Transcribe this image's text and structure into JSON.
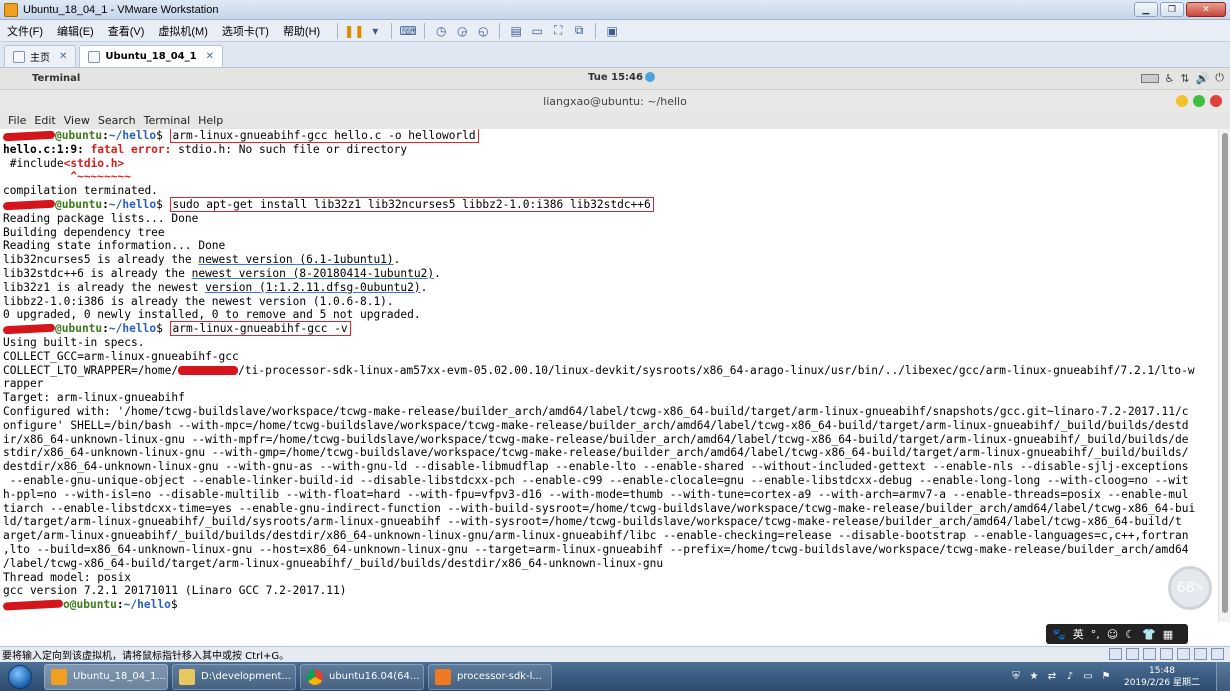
{
  "vmware": {
    "title": "Ubuntu_18_04_1 - VMware Workstation",
    "menu": [
      "文件(F)",
      "编辑(E)",
      "查看(V)",
      "虚拟机(M)",
      "选项卡(T)",
      "帮助(H)"
    ],
    "tabs": [
      {
        "label": "主页"
      },
      {
        "label": "Ubuntu_18_04_1",
        "active": true
      }
    ],
    "status_text": "要将输入定向到该虚拟机，请将鼠标指针移入其中或按 Ctrl+G。"
  },
  "ubuntu_panel": {
    "app_name": "Terminal",
    "clock": "Tue 15:46"
  },
  "terminal": {
    "window_title": "liangxao@ubuntu: ~/hello",
    "menu": [
      "File",
      "Edit",
      "View",
      "Search",
      "Terminal",
      "Help"
    ],
    "prompt_host": "@ubuntu",
    "prompt_path": "~/hello",
    "commands": {
      "c1": "arm-linux-gnueabihf-gcc hello.c -o helloworld",
      "c2": "sudo apt-get install lib32z1 lib32ncurses5 libbz2-1.0:i386 lib32stdc++6",
      "c3": "arm-linux-gnueabihf-gcc -v"
    },
    "output": {
      "err_loc": "hello.c:1:9: ",
      "err_label": "fatal error: ",
      "err_msg": "stdio.h: No such file or directory",
      "include_pre": " #include",
      "include_hdr": "<stdio.h>",
      "caret": "          ^~~~~~~~~",
      "compilation": "compilation terminated.",
      "r1": "Reading package lists... Done",
      "r2": "Building dependency tree",
      "r3": "Reading state information... Done",
      "r4a": "lib32ncurses5 is already the ",
      "r4b": "newest version (6.1-1ubuntu1)",
      "r4c": ".",
      "r5a": "lib32stdc++6 is already the ",
      "r5b": "newest version (8-20180414-1ubuntu2)",
      "r5c": ".",
      "r6a": "lib32z1 is already the newest ",
      "r6b": "version (1:1.2.11.dfsg-0ubuntu2)",
      "r6c": ".",
      "r7": "libbz2-1.0:i386 is already the newest version (1.0.6-8.1).",
      "r8": "0 upgraded, 0 newly installed, 0 to remove and 5 not upgraded.",
      "v1": "Using built-in specs.",
      "v2": "COLLECT_GCC=arm-linux-gnueabihf-gcc",
      "v3a": "COLLECT_LTO_WRAPPER=/home/",
      "v3b": "/ti-processor-sdk-linux-am57xx-evm-05.02.00.10/linux-devkit/sysroots/x86_64-arago-linux/usr/bin/../libexec/gcc/arm-linux-gnueabihf/7.2.1/lto-w",
      "v4": "rapper",
      "v5": "Target: arm-linux-gnueabihf",
      "v6": "Configured with: '/home/tcwg-buildslave/workspace/tcwg-make-release/builder_arch/amd64/label/tcwg-x86_64-build/target/arm-linux-gnueabihf/snapshots/gcc.git~linaro-7.2-2017.11/c",
      "v7": "onfigure' SHELL=/bin/bash --with-mpc=/home/tcwg-buildslave/workspace/tcwg-make-release/builder_arch/amd64/label/tcwg-x86_64-build/target/arm-linux-gnueabihf/_build/builds/destd",
      "v8": "ir/x86_64-unknown-linux-gnu --with-mpfr=/home/tcwg-buildslave/workspace/tcwg-make-release/builder_arch/amd64/label/tcwg-x86_64-build/target/arm-linux-gnueabihf/_build/builds/de",
      "v9": "stdir/x86_64-unknown-linux-gnu --with-gmp=/home/tcwg-buildslave/workspace/tcwg-make-release/builder_arch/amd64/label/tcwg-x86_64-build/target/arm-linux-gnueabihf/_build/builds/",
      "v10": "destdir/x86_64-unknown-linux-gnu --with-gnu-as --with-gnu-ld --disable-libmudflap --enable-lto --enable-shared --without-included-gettext --enable-nls --disable-sjlj-exceptions",
      "v11": " --enable-gnu-unique-object --enable-linker-build-id --disable-libstdcxx-pch --enable-c99 --enable-clocale=gnu --enable-libstdcxx-debug --enable-long-long --with-cloog=no --wit",
      "v12": "h-ppl=no --with-isl=no --disable-multilib --with-float=hard --with-fpu=vfpv3-d16 --with-mode=thumb --with-tune=cortex-a9 --with-arch=armv7-a --enable-threads=posix --enable-mul",
      "v13": "tiarch --enable-libstdcxx-time=yes --enable-gnu-indirect-function --with-build-sysroot=/home/tcwg-buildslave/workspace/tcwg-make-release/builder_arch/amd64/label/tcwg-x86_64-bui",
      "v14": "ld/target/arm-linux-gnueabihf/_build/sysroots/arm-linux-gnueabihf --with-sysroot=/home/tcwg-buildslave/workspace/tcwg-make-release/builder_arch/amd64/label/tcwg-x86_64-build/t",
      "v15": "arget/arm-linux-gnueabihf/_build/builds/destdir/x86_64-unknown-linux-gnu/arm-linux-gnueabihf/libc --enable-checking=release --disable-bootstrap --enable-languages=c,c++,fortran",
      "v16": ",lto --build=x86_64-unknown-linux-gnu --host=x86_64-unknown-linux-gnu --target=arm-linux-gnueabihf --prefix=/home/tcwg-buildslave/workspace/tcwg-make-release/builder_arch/amd64",
      "v17": "/label/tcwg-x86_64-build/target/arm-linux-gnueabihf/_build/builds/destdir/x86_64-unknown-linux-gnu",
      "v18": "Thread model: posix",
      "v19": "gcc version 7.2.1 20171011 (Linaro GCC 7.2-2017.11)"
    },
    "prompt_o": "o"
  },
  "overlay": {
    "zoom": "68",
    "zoom_unit": "%",
    "ime_lang": "英"
  },
  "taskbar": {
    "items": [
      {
        "label": "Ubuntu_18_04_1..."
      },
      {
        "label": "D:\\development..."
      },
      {
        "label": "ubuntu16.04(64..."
      },
      {
        "label": "processor-sdk-l..."
      }
    ],
    "time": "15:48",
    "date": "2019/2/26 星期二"
  },
  "colors": {
    "prompt_host": "#3b7b1d",
    "prompt_path": "#2a5fbf",
    "highlight_box": "#e0262b",
    "error": "#d81e1e"
  }
}
